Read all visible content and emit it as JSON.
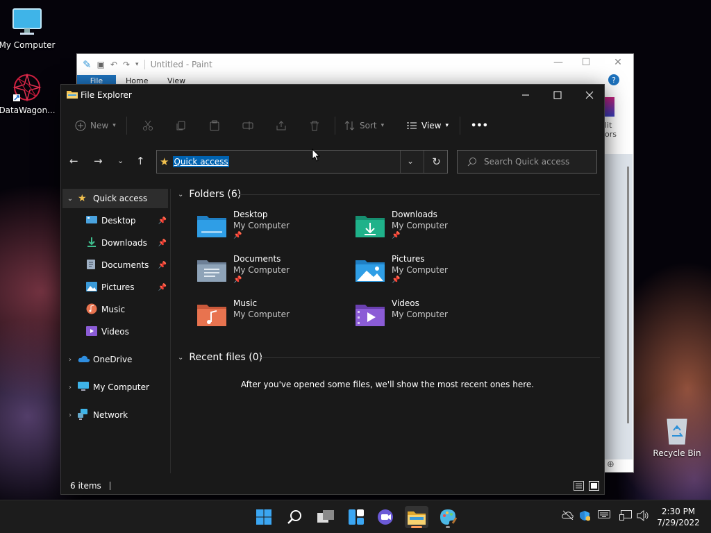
{
  "desktop": {
    "icons": [
      {
        "label": "My Computer"
      },
      {
        "label": "DataWagon..."
      },
      {
        "label": "Recycle Bin"
      }
    ]
  },
  "paint": {
    "title": "Untitled - Paint",
    "tabs": [
      "File",
      "Home",
      "View"
    ],
    "side_text": [
      "lit",
      "ors"
    ]
  },
  "explorer": {
    "title": "File Explorer",
    "toolbar": {
      "new": "New",
      "sort": "Sort",
      "view": "View",
      "more": "•••"
    },
    "address": "Quick access",
    "search_placeholder": "Search Quick access",
    "sidebar": [
      {
        "label": "Quick access",
        "icon": "star-icon"
      },
      {
        "label": "Desktop",
        "icon": "desktop-folder-icon",
        "pinned": true
      },
      {
        "label": "Downloads",
        "icon": "download-icon",
        "pinned": true
      },
      {
        "label": "Documents",
        "icon": "documents-icon",
        "pinned": true
      },
      {
        "label": "Pictures",
        "icon": "pictures-icon",
        "pinned": true
      },
      {
        "label": "Music",
        "icon": "music-icon"
      },
      {
        "label": "Videos",
        "icon": "videos-icon"
      },
      {
        "label": "OneDrive",
        "icon": "cloud-icon"
      },
      {
        "label": "My Computer",
        "icon": "computer-icon"
      },
      {
        "label": "Network",
        "icon": "network-icon"
      }
    ],
    "folders_heading": "Folders (6)",
    "folders": [
      {
        "name": "Desktop",
        "location": "My Computer",
        "pinned": true,
        "color": "#2f9ee6"
      },
      {
        "name": "Downloads",
        "location": "My Computer",
        "pinned": true,
        "color": "#1fb28a"
      },
      {
        "name": "Documents",
        "location": "My Computer",
        "pinned": true,
        "color": "#8ea3b8"
      },
      {
        "name": "Pictures",
        "location": "My Computer",
        "pinned": true,
        "color": "#2f9ee6"
      },
      {
        "name": "Music",
        "location": "My Computer",
        "pinned": false,
        "color": "#e8734f"
      },
      {
        "name": "Videos",
        "location": "My Computer",
        "pinned": false,
        "color": "#8b5cd6"
      }
    ],
    "recent_heading": "Recent files (0)",
    "recent_empty": "After you've opened some files, we'll show the most recent ones here.",
    "status": "6 items"
  },
  "taskbar": {
    "time": "2:30 PM",
    "date": "7/29/2022"
  },
  "colors": {
    "accent": "#0063b1",
    "folder_yellow": "#f2c14e"
  }
}
